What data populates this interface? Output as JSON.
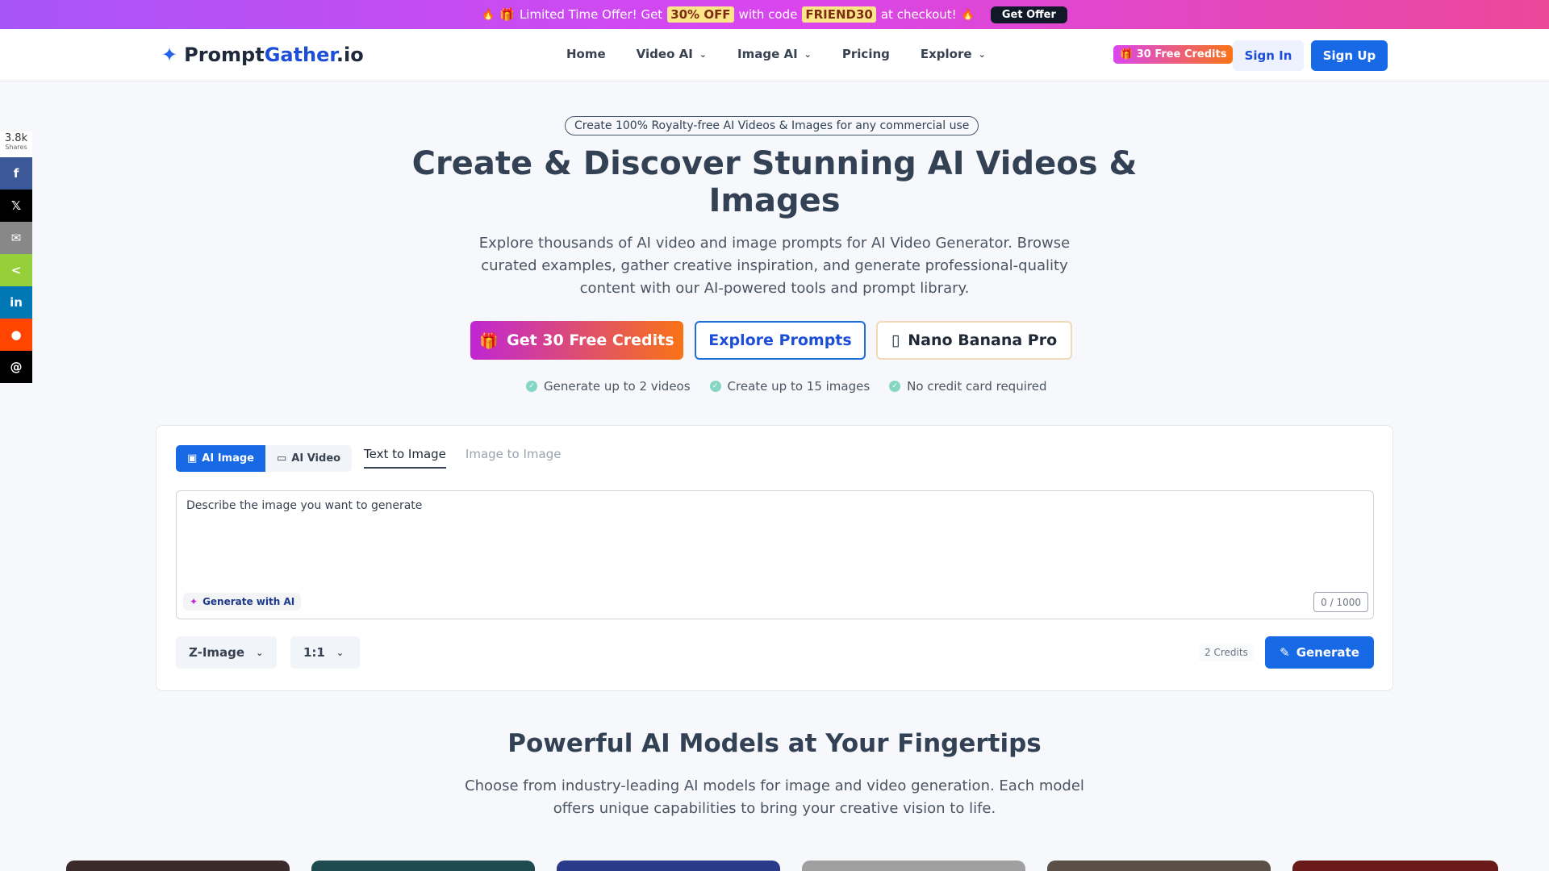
{
  "promo": {
    "icon_left": "fire-icon",
    "gift_glyph": "🎁",
    "prefix": "Limited Time Offer! Get",
    "discount": "30% OFF",
    "middle": "with code",
    "code": "FRIEND30",
    "suffix": "at checkout!",
    "button": "Get Offer"
  },
  "nav": {
    "logo_main": "Prompt",
    "logo_accent": "Gather",
    "logo_tld": ".io",
    "menu": [
      "Home",
      "Video AI",
      "Image AI",
      "Pricing",
      "Explore"
    ],
    "credits_badge": "30 Free Credits",
    "sign_in": "Sign In",
    "sign_up": "Sign Up"
  },
  "share": {
    "count": "3.8k",
    "count_label": "Shares",
    "buttons": [
      {
        "name": "facebook",
        "glyph": "f",
        "color": "#3b5998"
      },
      {
        "name": "x",
        "glyph": "𝕏",
        "color": "#000000"
      },
      {
        "name": "email",
        "glyph": "✉",
        "color": "#888888"
      },
      {
        "name": "share",
        "glyph": "<",
        "color": "#95d03a"
      },
      {
        "name": "linkedin",
        "glyph": "in",
        "color": "#0077b5"
      },
      {
        "name": "reddit",
        "glyph": "●",
        "color": "#ff4500"
      },
      {
        "name": "threads",
        "glyph": "@",
        "color": "#000000"
      }
    ]
  },
  "hero": {
    "pill": "Create 100% Royalty-free AI Videos & Images for any commercial use",
    "title": "Create & Discover Stunning AI Videos & Images",
    "subtitle": "Explore thousands of AI video and image prompts for AI Video Generator. Browse curated examples, gather creative inspiration, and generate professional-quality content with our AI-powered tools and prompt library.",
    "cta_primary": "Get 30 Free Credits",
    "cta_secondary": "Explore Prompts",
    "cta_tertiary": "Nano Banana Pro",
    "checks": [
      "Generate up to 2 videos",
      "Create up to 15 images",
      "No credit card required"
    ]
  },
  "generator": {
    "mode_image": "AI Image",
    "mode_video": "AI Video",
    "tab_text": "Text to Image",
    "tab_image": "Image to Image",
    "placeholder": "Describe the image you want to generate",
    "generate_with_ai": "Generate with AI",
    "counter": "0 / 1000",
    "model": "Z-Image",
    "ratio": "1:1",
    "cost": "2 Credits",
    "generate": "Generate"
  },
  "models": {
    "title": "Powerful AI Models at Your Fingertips",
    "subtitle": "Choose from industry-leading AI models for image and video generation. Each model offers unique capabilities to bring your creative vision to life.",
    "thumb_colors": [
      "#3a2a2a",
      "#1f4a4f",
      "#2a3a8a",
      "#a0a0a0",
      "#5a5048",
      "#6a1a1a"
    ]
  }
}
